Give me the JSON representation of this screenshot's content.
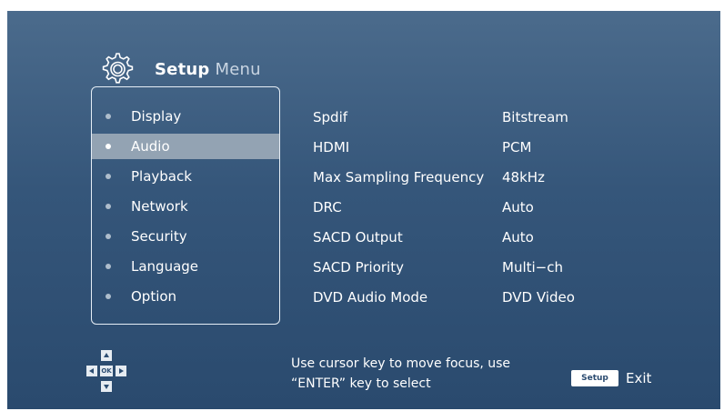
{
  "header": {
    "title_main": "Setup",
    "title_sub": "Menu",
    "icon": "gear-icon"
  },
  "menu": {
    "items": [
      {
        "label": "Display"
      },
      {
        "label": "Audio",
        "active": true
      },
      {
        "label": "Playback"
      },
      {
        "label": "Network"
      },
      {
        "label": "Security"
      },
      {
        "label": "Language"
      },
      {
        "label": "Option"
      }
    ]
  },
  "settings": [
    {
      "label": "Spdif",
      "value": "Bitstream"
    },
    {
      "label": "HDMI",
      "value": "PCM"
    },
    {
      "label": "Max Sampling Frequency",
      "value": "48kHz"
    },
    {
      "label": "DRC",
      "value": "Auto"
    },
    {
      "label": "SACD Output",
      "value": "Auto"
    },
    {
      "label": "SACD Priority",
      "value": "Multi−ch"
    },
    {
      "label": "DVD Audio Mode",
      "value": "DVD Video"
    }
  ],
  "footer": {
    "hint_line1": "Use cursor key to move focus, use",
    "hint_line2": "“ENTER” key to select",
    "setup_key": "Setup",
    "exit_label": "Exit",
    "ok_key": "OK"
  },
  "colors": {
    "background_top": "#4b6b8c",
    "background_bottom": "#2a4a6e",
    "active_row": "#93a3b3",
    "text": "#ffffff"
  }
}
